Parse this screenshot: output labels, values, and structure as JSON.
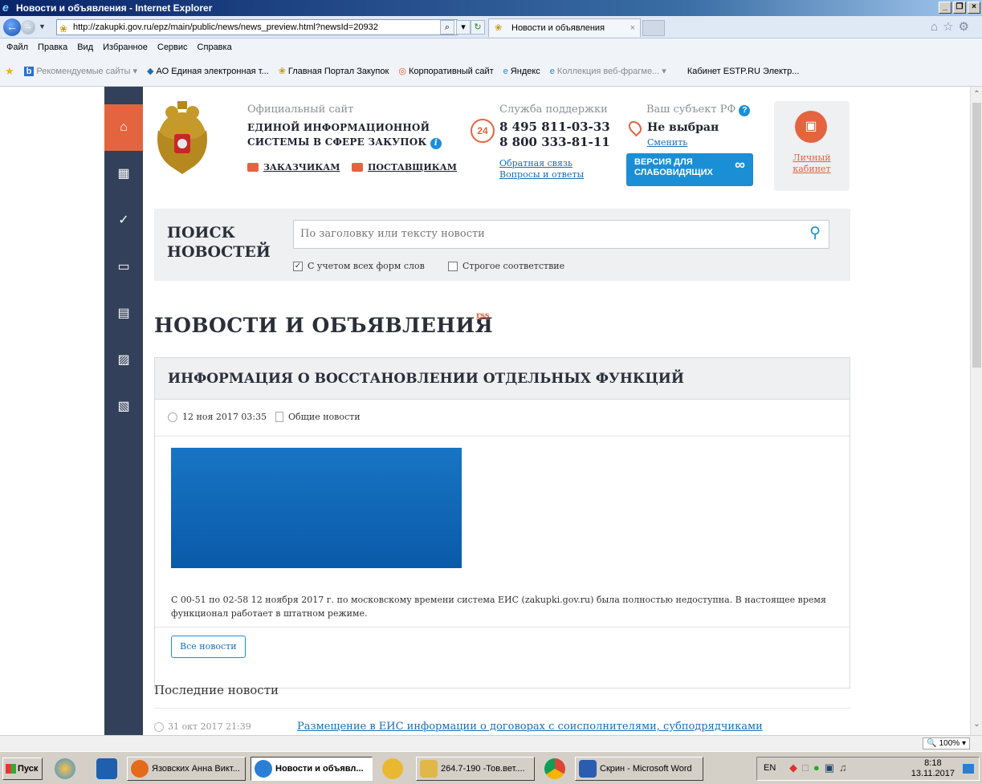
{
  "window": {
    "title": "Новости и объявления - Internet Explorer",
    "buttons": [
      "_",
      "❒",
      "×"
    ]
  },
  "browser": {
    "url": "http://zakupki.gov.ru/epz/main/public/news/news_preview.html?newsId=20932",
    "tab_title": "Новости и объявления",
    "menu": [
      "Файл",
      "Правка",
      "Вид",
      "Избранное",
      "Сервис",
      "Справка"
    ],
    "favorites": [
      {
        "label": "Рекомендуемые сайты ▾",
        "muted": true
      },
      {
        "label": "АО Единая электронная т...",
        "muted": false
      },
      {
        "label": "Главная Портал Закупок",
        "muted": false
      },
      {
        "label": "Корпоративный сайт",
        "muted": false
      },
      {
        "label": "Яндекс",
        "muted": false
      },
      {
        "label": "Коллекция веб-фрагме... ▾",
        "muted": true
      },
      {
        "label": "Кабинет ESTP.RU Электр...",
        "muted": false
      }
    ]
  },
  "site": {
    "official_caption": "Официальный сайт",
    "system_name_1": "ЕДИНОЙ ИНФОРМАЦИОННОЙ",
    "system_name_2": "СИСТЕМЫ В СФЕРЕ ЗАКУПОК",
    "customers_link": "ЗАКАЗЧИКАМ",
    "suppliers_link": "ПОСТАВЩИКАМ",
    "support_caption": "Служба поддержки",
    "support_badge": "24",
    "phone_1": "8 495 811-03-33",
    "phone_2": "8 800 333-81-11",
    "feedback_link": "Обратная связь",
    "faq_link": "Вопросы и ответы",
    "region_caption": "Ваш субъект РФ",
    "region_value": "Не выбран",
    "region_change": "Сменить",
    "low_vision_1": "ВЕРСИЯ ДЛЯ",
    "low_vision_2": "СЛАБОВИДЯЩИХ",
    "cabinet_1": "Личный",
    "cabinet_2": "кабинет",
    "accent_color": "#e4643f",
    "blue_color": "#1a8fd6"
  },
  "search": {
    "title_1": "ПОИСК",
    "title_2": "НОВОСТЕЙ",
    "placeholder": "По заголовку или тексту новости",
    "option_all_forms": "С учетом всех форм слов",
    "option_all_forms_checked": true,
    "option_strict": "Строгое соответствие",
    "option_strict_checked": false
  },
  "news": {
    "page_title": "НОВОСТИ И ОБЪЯВЛЕНИЯ",
    "rss_label": "rss",
    "article": {
      "title": "ИНФОРМАЦИЯ О ВОССТАНОВЛЕНИИ ОТДЕЛЬНЫХ ФУНКЦИЙ",
      "date": "12 ноя 2017 03:35",
      "category": "Общие новости",
      "body_1": "С 00-51 по 02-58 12 ноября 2017 г. по московскому времени система ЕИС (zakupki.gov.ru) была полностью недоступна. В настоящее время",
      "body_2": "функционал работает в штатном режиме."
    },
    "all_news_button": "Все новости",
    "latest_heading": "Последние новости",
    "latest": [
      {
        "date": "31 окт 2017 21:39",
        "title": "Размещение в ЕИС информации о договорах с соисполнителями, субподрядчиками"
      }
    ]
  },
  "status": {
    "zoom": "100%"
  },
  "taskbar": {
    "start": "Пуск",
    "tasks": [
      {
        "label": "Язовских Анна Викт...",
        "active": false,
        "color": "#e56a1a"
      },
      {
        "label": "Новости и объявл...",
        "active": true,
        "color": "#2a7fd4"
      },
      {
        "label": "264.7-190 -Тов.вет....",
        "active": false,
        "color": "#e0b84a"
      },
      {
        "label": "Скрин - Microsoft Word",
        "active": false,
        "color": "#2b5cb0"
      }
    ],
    "lang": "EN",
    "time": "8:18",
    "date": "13.11.2017"
  }
}
